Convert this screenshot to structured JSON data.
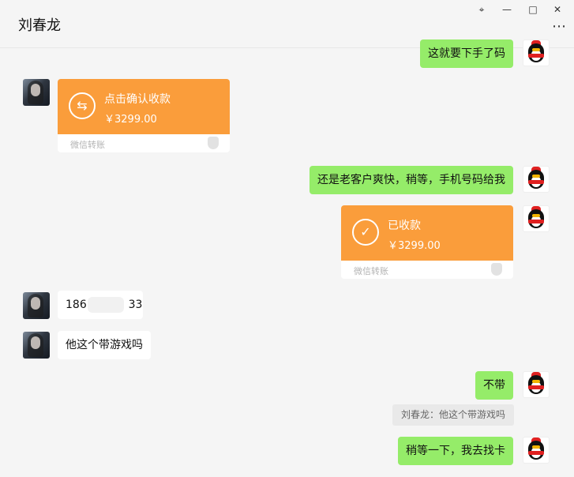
{
  "chat": {
    "title": "刘春龙",
    "icons": {
      "pin": "pin-icon",
      "minimize": "minimize-icon",
      "maximize": "maximize-icon",
      "close": "close-icon",
      "more": "more-icon"
    }
  },
  "messages": {
    "m1": {
      "text": "这就要下手了码"
    },
    "m2": {
      "title": "点击确认收款",
      "amount": "￥3299.00",
      "footer": "微信转账"
    },
    "m3": {
      "text": "还是老客户爽快，稍等，手机号码给我"
    },
    "m4": {
      "title": "已收款",
      "amount": "￥3299.00",
      "footer": "微信转账"
    },
    "m5": {
      "text_prefix": "186",
      "text_suffix": "33"
    },
    "m6": {
      "text": "他这个带游戏吗"
    },
    "m7": {
      "text": "不带"
    },
    "m7_quote": {
      "text": "刘春龙：他这个带游戏吗"
    },
    "m8": {
      "text": "稍等一下，我去找卡"
    }
  },
  "colors": {
    "chat_bg": "#f5f5f5",
    "my_bubble": "#95ec69",
    "other_bubble": "#ffffff",
    "transfer": "#fa9d3b"
  }
}
